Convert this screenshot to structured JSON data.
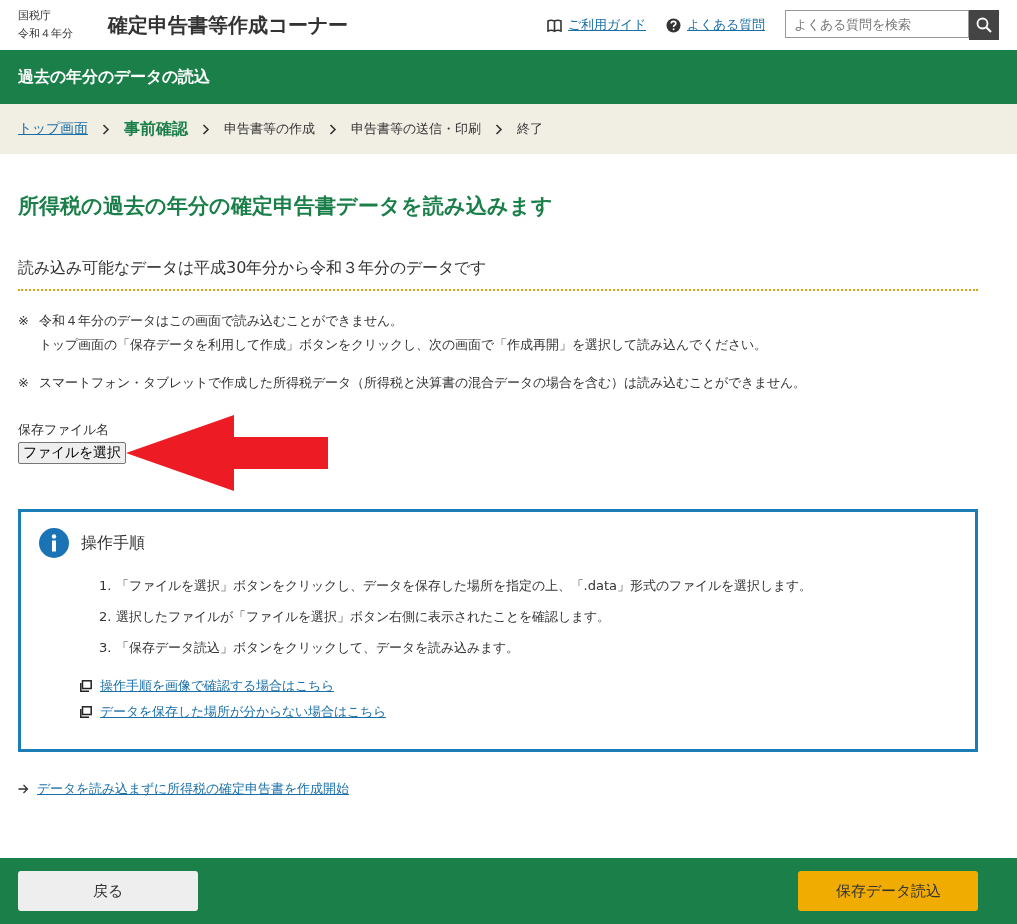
{
  "header": {
    "agency": "国税庁",
    "year": "令和４年分",
    "title": "確定申告書等作成コーナー",
    "links": [
      {
        "label": "ご利用ガイド"
      },
      {
        "label": "よくある質問"
      }
    ],
    "search": {
      "placeholder": "よくある質問を検索"
    }
  },
  "page_title": "過去の年分のデータの読込",
  "breadcrumb": [
    {
      "label": "トップ画面",
      "kind": "link"
    },
    {
      "label": "事前確認",
      "kind": "current"
    },
    {
      "label": "申告書等の作成",
      "kind": "plain"
    },
    {
      "label": "申告書等の送信・印刷",
      "kind": "plain"
    },
    {
      "label": "終了",
      "kind": "plain"
    }
  ],
  "heading": "所得税の過去の年分の確定申告書データを読み込みます",
  "subheading": "読み込み可能なデータは平成30年分から令和３年分のデータです",
  "notes": [
    {
      "mark": "※",
      "lines": [
        "令和４年分のデータはこの画面で読み込むことができません。",
        "トップ画面の「保存データを利用して作成」ボタンをクリックし、次の画面で「作成再開」を選択して読み込んでください。"
      ]
    },
    {
      "mark": "※",
      "lines": [
        "スマートフォン・タブレットで作成した所得税データ（所得税と決算書の混合データの場合を含む）は読み込むことができません。"
      ]
    }
  ],
  "file_field": {
    "label": "保存ファイル名",
    "button": "ファイルを選択"
  },
  "instructions": {
    "title": "操作手順",
    "steps": [
      "1. 「ファイルを選択」ボタンをクリックし、データを保存した場所を指定の上、「.data」形式のファイルを選択します。",
      "2. 選択したファイルが「ファイルを選択」ボタン右側に表示されたことを確認します。",
      "3. 「保存データ読込」ボタンをクリックして、データを読み込みます。"
    ],
    "links": [
      "操作手順を画像で確認する場合はこちら",
      "データを保存した場所が分からない場合はこちら"
    ]
  },
  "start_link": "データを読み込まずに所得税の確定申告書を作成開始",
  "footer": {
    "back": "戻る",
    "load": "保存データ読込"
  }
}
